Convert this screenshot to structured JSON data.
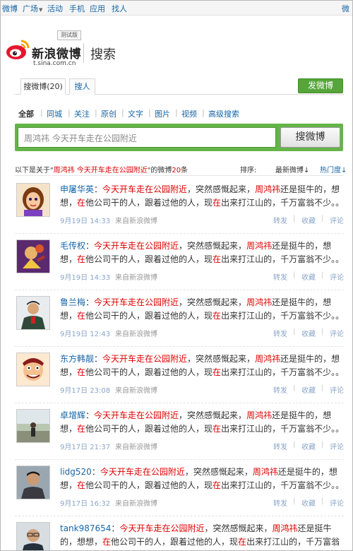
{
  "topnav": {
    "items": [
      "微博",
      "广场",
      "活动",
      "手机",
      "应用",
      "找人"
    ],
    "right_label": "微"
  },
  "brand": {
    "name": "新浪微博",
    "url": "t.sina.com.cn",
    "badge": "测试版",
    "section": "搜索",
    "colors": {
      "logo_red": "#e6162d",
      "logo_yellow": "#f5a300"
    }
  },
  "tabs": {
    "search_weibo": "搜微博(20)",
    "search_people": "搜人",
    "post_button": "发微博"
  },
  "filters": [
    "全部",
    "同城",
    "关注",
    "原创",
    "文字",
    "图片",
    "视频",
    "高级搜索"
  ],
  "search": {
    "value": "周鸿祎 今天开车走在公园附近",
    "button": "搜微博"
  },
  "results_header": {
    "prefix": "以下是关于\"",
    "query": "周鸿祎 今天开车走在公园附近",
    "suffix": "\"的微博",
    "count": "20",
    "count_unit": "条",
    "sort_label": "排序:",
    "sort_latest": "最新微博↓",
    "sort_hot": "热门度↓"
  },
  "post_text": {
    "kw1": "今天开车走在公园附近",
    "t1": "，突然感慨起来，",
    "kw2": "周鸿祎",
    "t2": "还是挺牛的，想想，",
    "kw3": "在",
    "t3": "他公司干的人，跟着过他的人，现",
    "kw4": "在",
    "t4": "出来打江山的，千万富翁不少。。"
  },
  "post_actions": {
    "repost": "转发",
    "favorite": "收藏",
    "comment": "评论"
  },
  "posts": [
    {
      "user": "申屠华英",
      "time": "9月19日 14:33",
      "source": "来自新浪微博",
      "avatar": "cartoon-girl"
    },
    {
      "user": "毛传权",
      "time": "9月19日 14:33",
      "source": "来自新浪微博",
      "avatar": "game-character"
    },
    {
      "user": "鲁兰梅",
      "time": "9月19日 12:43",
      "source": "来自新浪微博",
      "avatar": "uniformed-officer"
    },
    {
      "user": "东方韩靓",
      "time": "9月17日 23:08",
      "source": "来自新浪微博",
      "avatar": "cartoon-man"
    },
    {
      "user": "卓增辉",
      "time": "9月17日 21:37",
      "source": "来自新浪微博",
      "avatar": "person-outdoors"
    },
    {
      "user": "lidg520",
      "time": "9月17日 16:32",
      "source": "来自新浪微博",
      "avatar": "man-portrait"
    },
    {
      "user": "tank987654",
      "time": "",
      "source": "",
      "avatar": "man-with-glasses"
    }
  ]
}
